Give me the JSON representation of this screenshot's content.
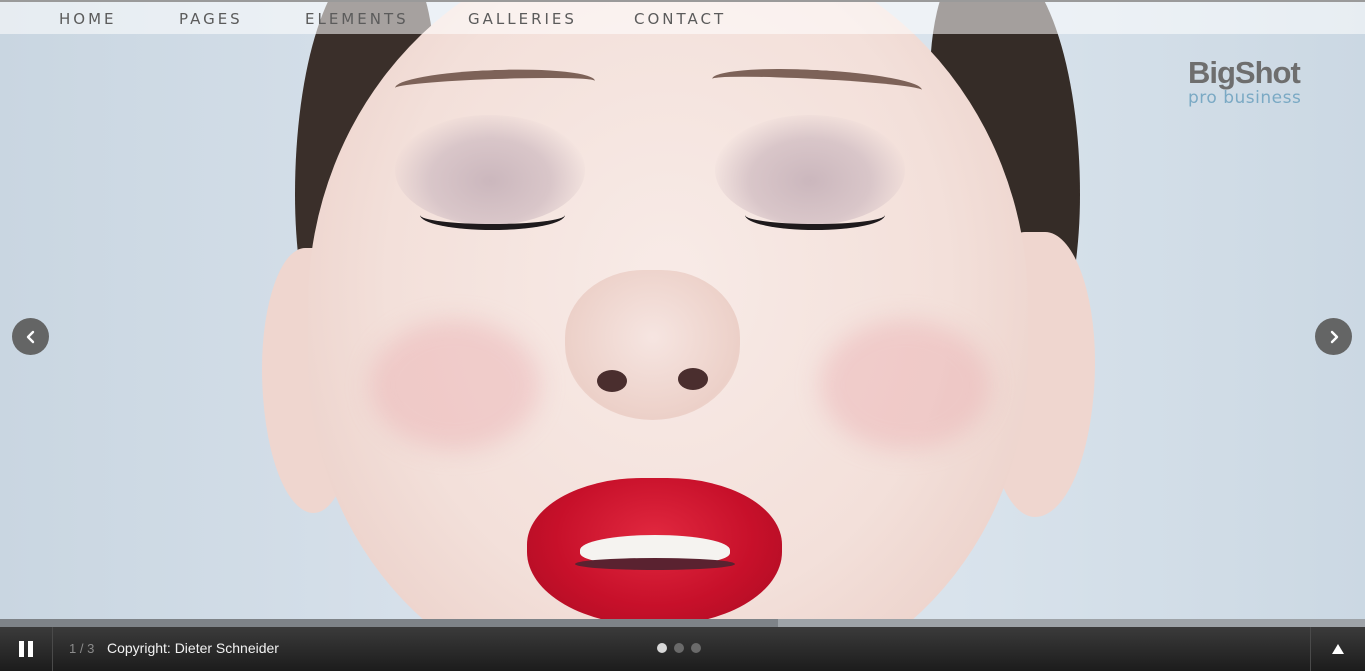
{
  "nav": {
    "items": [
      {
        "label": "HOME"
      },
      {
        "label": "PAGES"
      },
      {
        "label": "ELEMENTS"
      },
      {
        "label": "GALLERIES"
      },
      {
        "label": "CONTACT"
      }
    ]
  },
  "logo": {
    "title": "BigShot",
    "subtitle": "pro business"
  },
  "slideshow": {
    "prev_icon": "chevron-left-icon",
    "next_icon": "chevron-right-icon",
    "progress_fraction": 0.57
  },
  "bottom_bar": {
    "counter": "1 / 3",
    "caption": "Copyright: Dieter Schneider",
    "dots": [
      true,
      false,
      false
    ],
    "pause_icon": "pause-icon",
    "up_icon": "arrow-up-icon"
  },
  "colors": {
    "logo_text": "#6e6e6e",
    "logo_subtitle": "#7aa9c4",
    "bar_background": "#2a2a2a"
  }
}
